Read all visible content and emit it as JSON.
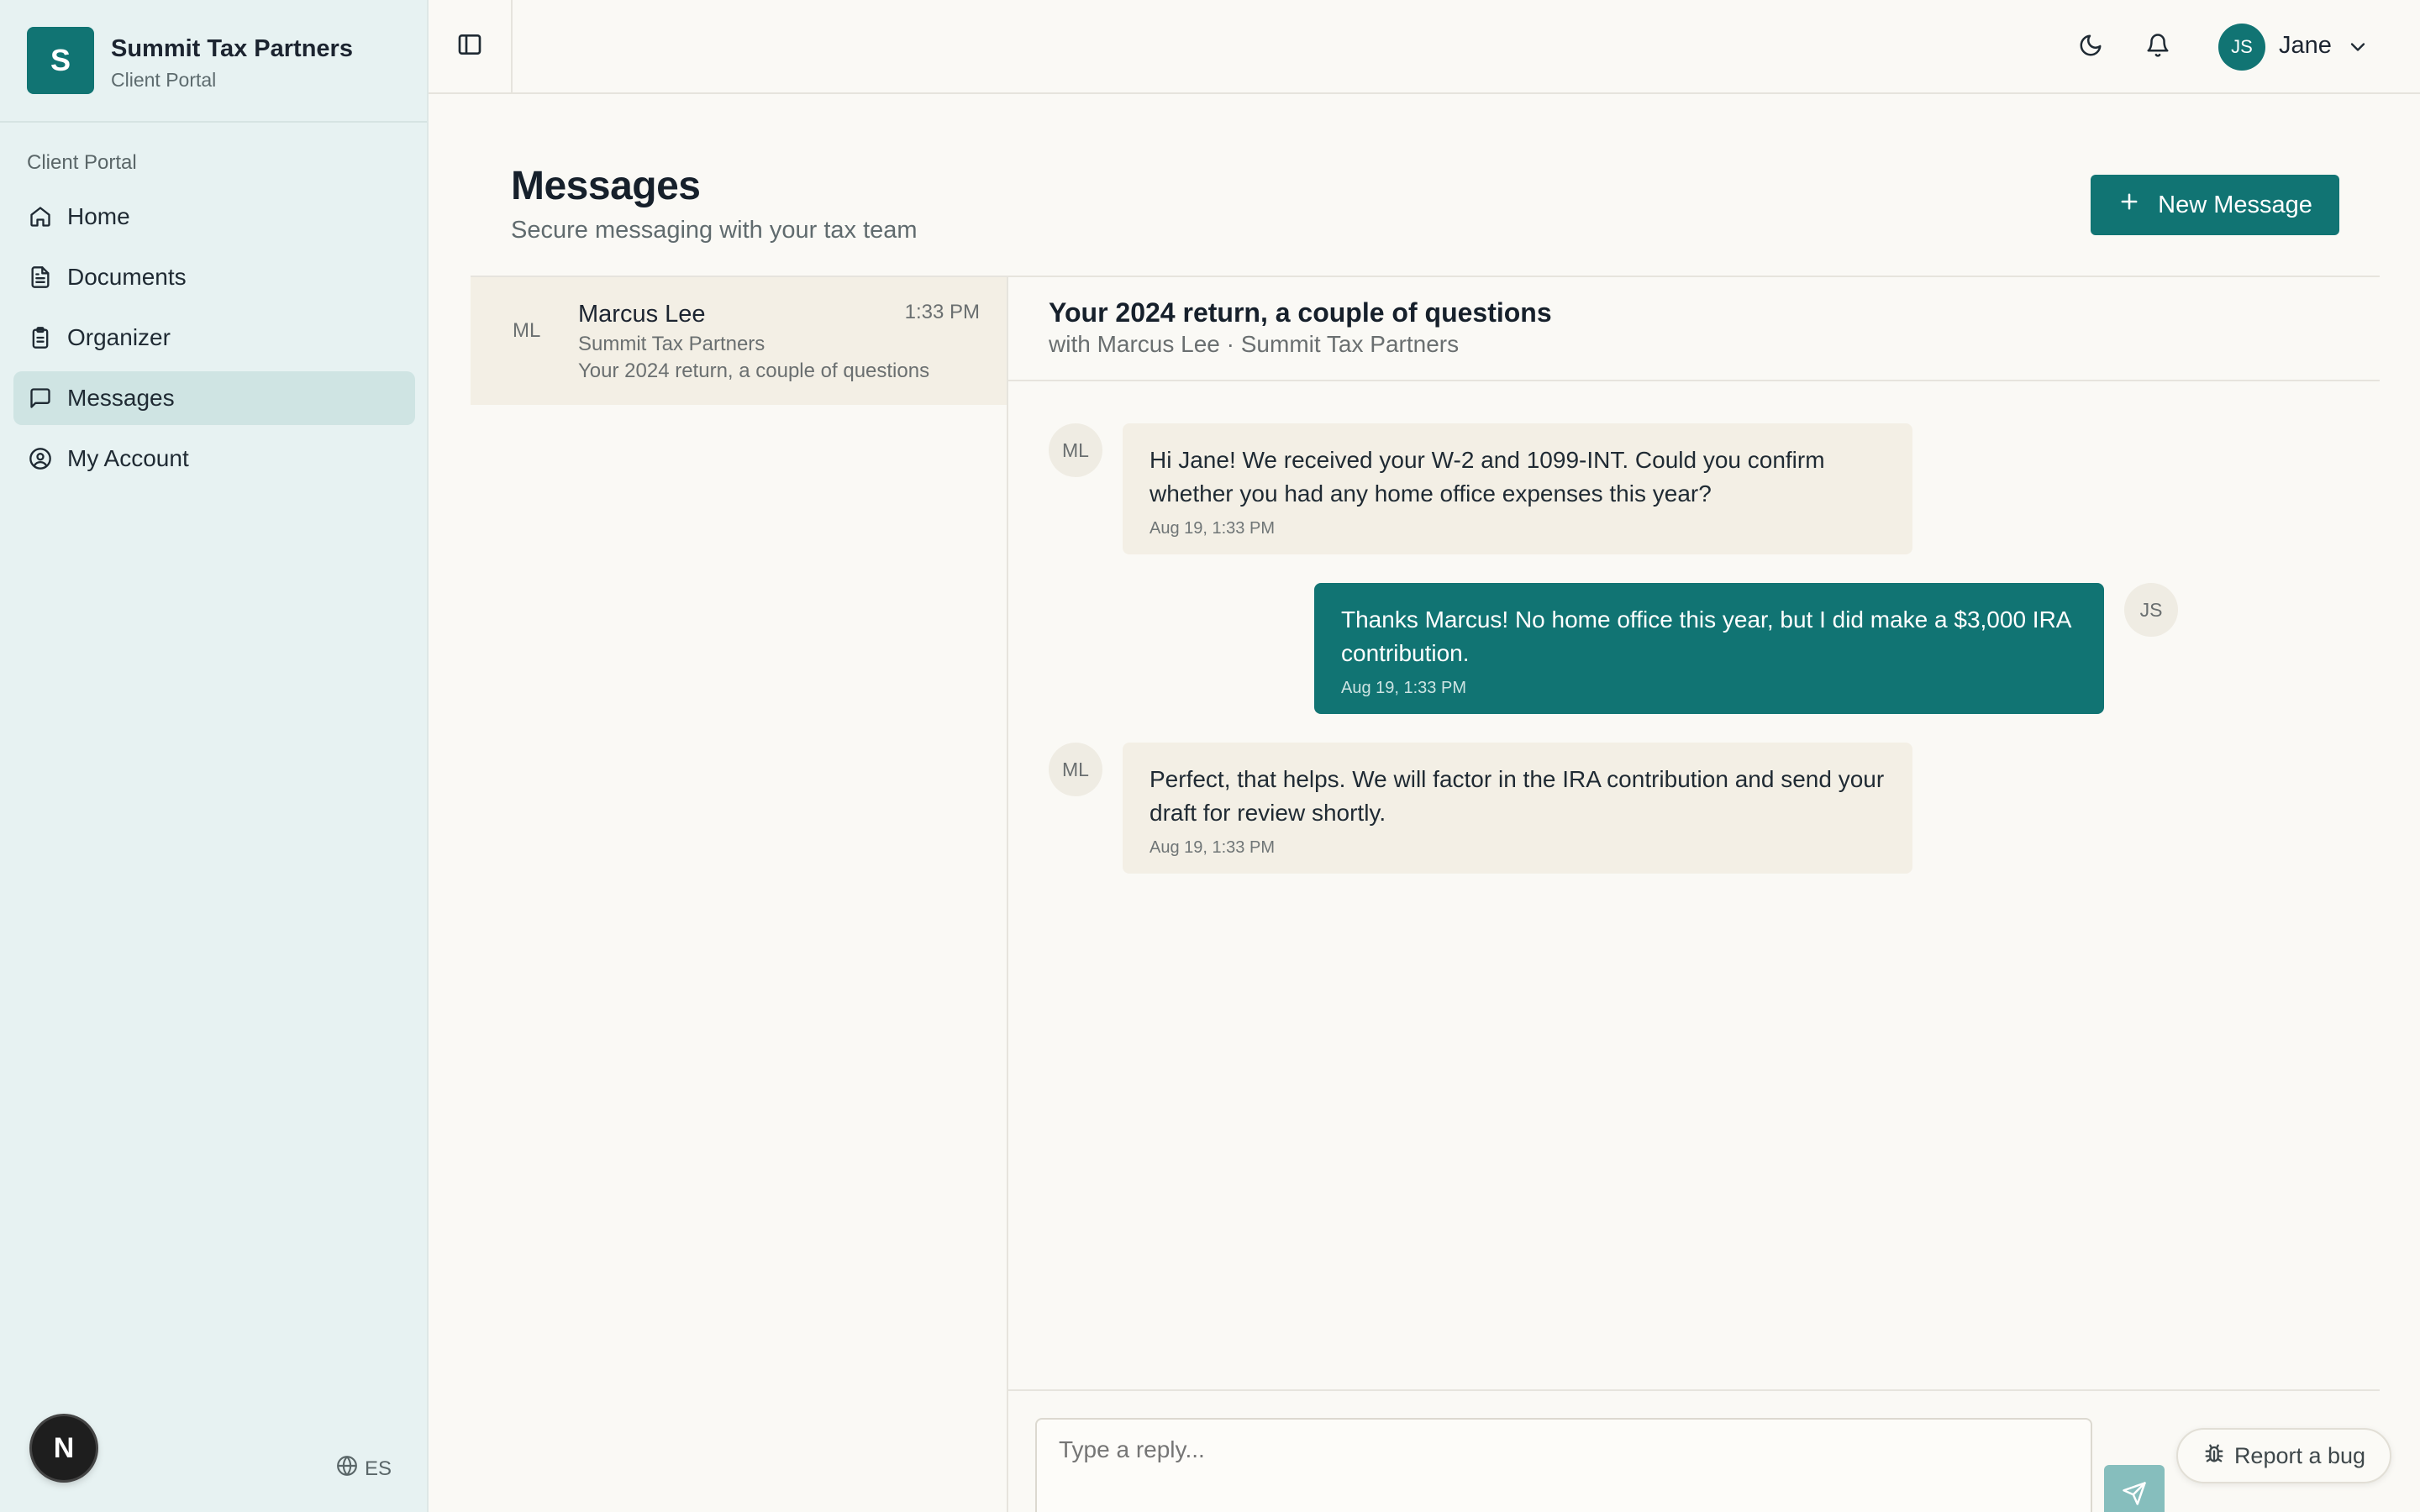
{
  "brand": {
    "logo_letter": "S",
    "name": "Summit Tax Partners",
    "subtitle": "Client Portal"
  },
  "sidebar": {
    "section_label": "Client Portal",
    "items": [
      {
        "label": "Home",
        "icon": "home-icon",
        "active": false
      },
      {
        "label": "Documents",
        "icon": "document-icon",
        "active": false
      },
      {
        "label": "Organizer",
        "icon": "clipboard-icon",
        "active": false
      },
      {
        "label": "Messages",
        "icon": "message-icon",
        "active": true
      },
      {
        "label": "My Account",
        "icon": "user-circle-icon",
        "active": false
      }
    ],
    "badge_letter": "N",
    "language": "ES"
  },
  "topbar": {
    "user_initials": "JS",
    "user_name": "Jane"
  },
  "page": {
    "title": "Messages",
    "subtitle": "Secure messaging with your tax team",
    "new_message_label": "New Message"
  },
  "conversations": [
    {
      "initials": "ML",
      "name": "Marcus Lee",
      "time": "1:33 PM",
      "firm": "Summit Tax Partners",
      "subject": "Your 2024 return, a couple of questions"
    }
  ],
  "thread": {
    "title": "Your 2024 return, a couple of questions",
    "with": "with Marcus Lee · Summit Tax Partners",
    "messages": [
      {
        "direction": "in",
        "initials": "ML",
        "text": "Hi Jane! We received your W-2 and 1099-INT. Could you confirm whether you had any home office expenses this year?",
        "time": "Aug 19, 1:33 PM"
      },
      {
        "direction": "out",
        "initials": "JS",
        "text": "Thanks Marcus! No home office this year, but I did make a $3,000 IRA contribution.",
        "time": "Aug 19, 1:33 PM"
      },
      {
        "direction": "in",
        "initials": "ML",
        "text": "Perfect, that helps. We will factor in the IRA contribution and send your draft for review shortly.",
        "time": "Aug 19, 1:33 PM"
      }
    ],
    "reply_placeholder": "Type a reply..."
  },
  "report_bug_label": "Report a bug",
  "colors": {
    "accent": "#117473",
    "sidebar_bg": "#e7f2f2",
    "page_bg": "#faf9f5",
    "bubble_in": "#f3efe5"
  }
}
